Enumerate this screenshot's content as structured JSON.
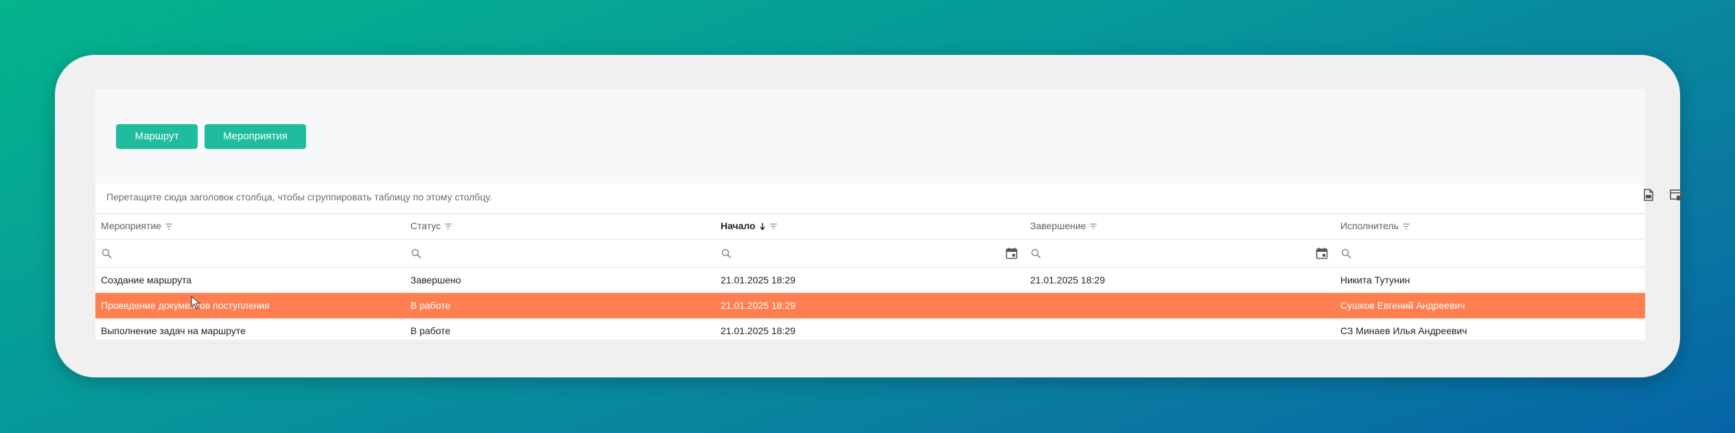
{
  "toolbar": {
    "route_label": "Маршрут",
    "events_label": "Мероприятия"
  },
  "grouping": {
    "hint": "Перетащите сюда заголовок столбца, чтобы сгруппировать таблицу по этому столбцу."
  },
  "icons": {
    "export": "export-document-icon",
    "column_chooser": "column-chooser-icon",
    "filter": "filter-icon",
    "sort": "sort-descending-arrow-icon",
    "search": "search-icon",
    "calendar": "calendar-icon"
  },
  "colors": {
    "accent": "#1fbd9d",
    "selected_row": "#ff7f50"
  },
  "table": {
    "columns": [
      "Мероприятие",
      "Статус",
      "Начало",
      "Завершение",
      "Исполнитель"
    ],
    "sorted_column": "Начало",
    "rows": [
      [
        "Создание маршрута",
        "Завершено",
        "21.01.2025 18:29",
        "21.01.2025 18:29",
        "Никита Тутунин"
      ],
      [
        "Проведение документов поступления",
        "В работе",
        "21.01.2025 18:29",
        "",
        "Сушков Евгений Андреевич"
      ],
      [
        "Выполнение задач на маршруте",
        "В работе",
        "21.01.2025 18:29",
        "",
        "СЗ Минаев Илья Андреевич"
      ]
    ],
    "selected_row_index": 1
  }
}
